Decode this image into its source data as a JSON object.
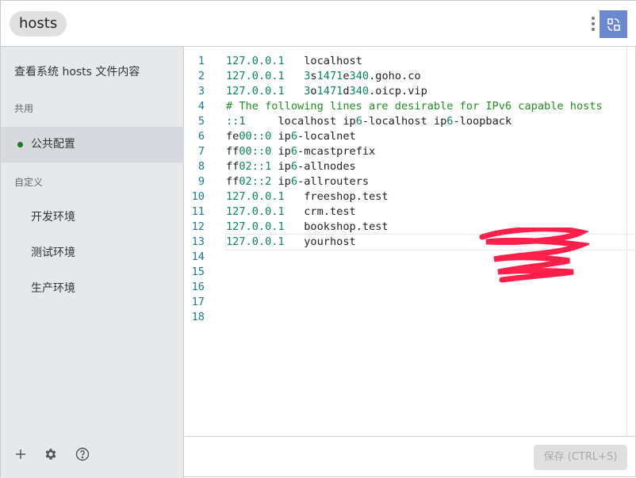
{
  "header": {
    "title": "hosts",
    "icons": {
      "menu": "more-vertical-icon",
      "switch": "swap-view-icon"
    }
  },
  "sidebar": {
    "view_system_hosts": "查看系统 hosts 文件内容",
    "sections": [
      {
        "label": "共用",
        "items": [
          {
            "label": "公共配置",
            "active": true,
            "enabled": true
          }
        ]
      },
      {
        "label": "自定义",
        "items": [
          {
            "label": "开发环境"
          },
          {
            "label": "测试环境"
          },
          {
            "label": "生产环境"
          }
        ]
      }
    ],
    "footer_icons": [
      "plus-icon",
      "gear-icon",
      "help-icon"
    ]
  },
  "editor": {
    "current_line": 13,
    "lines": [
      [
        [
          "num",
          "127.0.0.1"
        ],
        [
          "t",
          "   localhost"
        ]
      ],
      [
        [
          "num",
          "127.0.0.1"
        ],
        [
          "t",
          "   "
        ],
        [
          "num",
          "3"
        ],
        [
          "t",
          "s"
        ],
        [
          "num",
          "1471"
        ],
        [
          "t",
          "e"
        ],
        [
          "num",
          "340"
        ],
        [
          "t",
          ".goho.co"
        ]
      ],
      [
        [
          "num",
          "127.0.0.1"
        ],
        [
          "t",
          "   "
        ],
        [
          "num",
          "3"
        ],
        [
          "t",
          "o"
        ],
        [
          "num",
          "1471"
        ],
        [
          "t",
          "d"
        ],
        [
          "num",
          "340"
        ],
        [
          "t",
          ".oicp.vip"
        ]
      ],
      [
        [
          "cm",
          "# The following lines are desirable for IPv6 capable hosts"
        ]
      ],
      [
        [
          "num",
          "::1"
        ],
        [
          "t",
          "     localhost ip"
        ],
        [
          "num",
          "6"
        ],
        [
          "t",
          "-localhost ip"
        ],
        [
          "num",
          "6"
        ],
        [
          "t",
          "-loopback"
        ]
      ],
      [
        [
          "t",
          "fe"
        ],
        [
          "num",
          "00::0"
        ],
        [
          "t",
          " ip"
        ],
        [
          "num",
          "6"
        ],
        [
          "t",
          "-localnet"
        ]
      ],
      [
        [
          "t",
          "ff"
        ],
        [
          "num",
          "00::0"
        ],
        [
          "t",
          " ip"
        ],
        [
          "num",
          "6"
        ],
        [
          "t",
          "-mcastprefix"
        ]
      ],
      [
        [
          "t",
          "ff"
        ],
        [
          "num",
          "02::1"
        ],
        [
          "t",
          " ip"
        ],
        [
          "num",
          "6"
        ],
        [
          "t",
          "-allnodes"
        ]
      ],
      [
        [
          "t",
          "ff"
        ],
        [
          "num",
          "02::2"
        ],
        [
          "t",
          " ip"
        ],
        [
          "num",
          "6"
        ],
        [
          "t",
          "-allrouters"
        ]
      ],
      [
        [
          "num",
          "127.0.0.1"
        ],
        [
          "t",
          "   freeshop.test"
        ]
      ],
      [
        [
          "num",
          "127.0.0.1"
        ],
        [
          "t",
          "   crm.test"
        ]
      ],
      [
        [
          "num",
          "127.0.0.1"
        ],
        [
          "t",
          "   bookshop.test"
        ]
      ],
      [
        [
          "num",
          "127.0.0.1"
        ],
        [
          "t",
          "   yourhost"
        ]
      ],
      [],
      [],
      [],
      [],
      []
    ],
    "redaction_color": "#ff1f4b"
  },
  "footer": {
    "save_label": "保存 (CTRL+S)",
    "save_enabled": false
  }
}
